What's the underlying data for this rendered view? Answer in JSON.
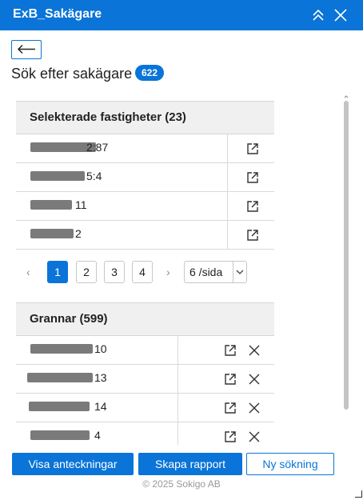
{
  "window": {
    "title": "ExB_Sakägare"
  },
  "header": {
    "heading": "Sök efter sakägare",
    "count_badge": "622"
  },
  "selected": {
    "title": "Selekterade fastigheter (23)",
    "rows": [
      {
        "text": "2:87"
      },
      {
        "text": "5:4"
      },
      {
        "text": "11"
      },
      {
        "text": "2"
      }
    ]
  },
  "pagination": {
    "prev": "‹",
    "pages": [
      "1",
      "2",
      "3",
      "4"
    ],
    "active_page": "1",
    "next": "›",
    "page_size": "6 /sida",
    "page_size_options": [
      "6 /sida"
    ]
  },
  "neighbors": {
    "title": "Grannar (599)",
    "rows": [
      {
        "text": "10"
      },
      {
        "text": "13"
      },
      {
        "text": "14"
      },
      {
        "text": "4"
      }
    ]
  },
  "actions": {
    "show_notes": "Visa anteckningar",
    "create_report": "Skapa rapport",
    "new_search": "Ny sökning"
  },
  "footer": {
    "copyright": "© 2025 Sokigo AB"
  },
  "colors": {
    "accent": "#0a74d8",
    "header_bg": "#f0f0f0",
    "redaction": "#7a7a7a"
  }
}
